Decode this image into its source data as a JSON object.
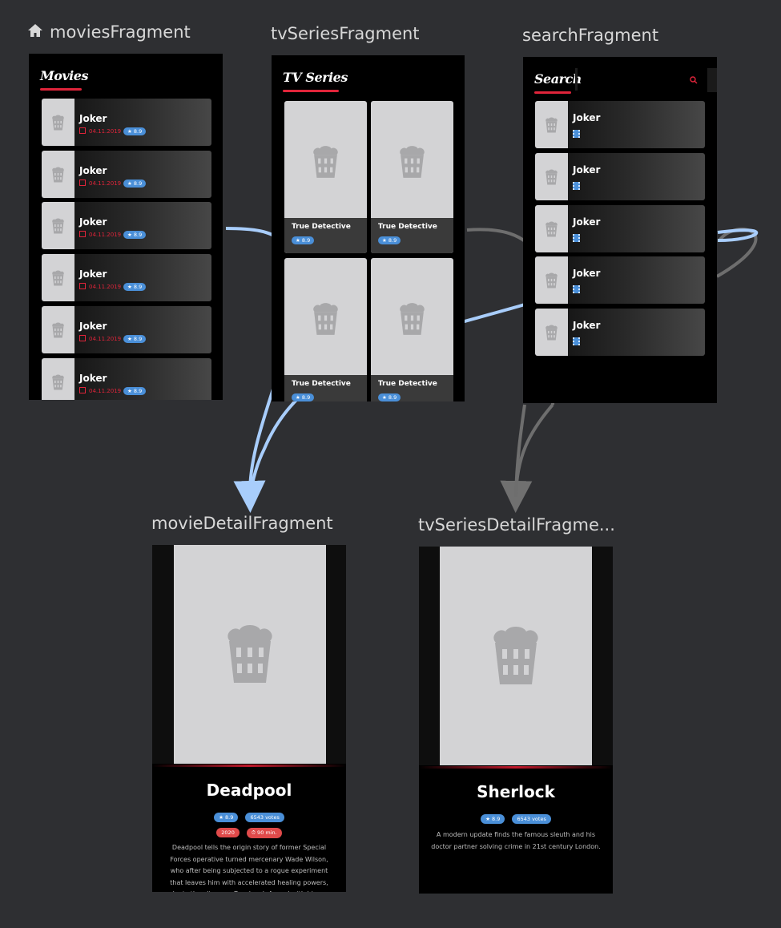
{
  "fragments": {
    "movies": {
      "label": "moviesFragment",
      "screen_title": "Movies",
      "items": [
        {
          "title": "Joker",
          "date": "04.11.2019",
          "rating": "★ 8.9"
        },
        {
          "title": "Joker",
          "date": "04.11.2019",
          "rating": "★ 8.9"
        },
        {
          "title": "Joker",
          "date": "04.11.2019",
          "rating": "★ 8.9"
        },
        {
          "title": "Joker",
          "date": "04.11.2019",
          "rating": "★ 8.9"
        },
        {
          "title": "Joker",
          "date": "04.11.2019",
          "rating": "★ 8.9"
        },
        {
          "title": "Joker",
          "date": "04.11.2019",
          "rating": "★ 8.9"
        }
      ]
    },
    "tvSeries": {
      "label": "tvSeriesFragment",
      "screen_title": "TV Series",
      "items": [
        {
          "title": "True Detective",
          "rating": "★ 8.9"
        },
        {
          "title": "True Detective",
          "rating": "★ 8.9"
        },
        {
          "title": "True Detective",
          "rating": "★ 8.9"
        },
        {
          "title": "True Detective",
          "rating": "★ 8.9"
        }
      ]
    },
    "search": {
      "label": "searchFragment",
      "screen_title": "Search",
      "items": [
        {
          "title": "Joker"
        },
        {
          "title": "Joker"
        },
        {
          "title": "Joker"
        },
        {
          "title": "Joker"
        },
        {
          "title": "Joker"
        }
      ]
    },
    "movieDetail": {
      "label": "movieDetailFragment",
      "title": "Deadpool",
      "rating": "★ 8.9",
      "votes": "6543 votes",
      "year": "2020",
      "runtime": "⏱ 90 min.",
      "description": "Deadpool tells the origin story of former Special Forces operative turned mercenary Wade Wilson, who after being subjected to a rogue experiment that leaves him with accelerated healing powers, adopts the alter ego Deadpool. Armed with his new abilities and a dark"
    },
    "tvSeriesDetail": {
      "label": "tvSeriesDetailFragme...",
      "title": "Sherlock",
      "rating": "★ 8.9",
      "votes": "6543 votes",
      "description": "A modern update finds the famous sleuth and his doctor partner solving crime in 21st century London."
    }
  },
  "colors": {
    "canvas": "#2e2f32",
    "accent_red": "#e0243a",
    "badge_blue": "#4a8fd8",
    "arrow_selected": "#a8cdfb",
    "arrow_default": "#707070"
  },
  "icons": {
    "start_destination": "home-icon",
    "placeholder": "popcorn-icon",
    "search": "search-icon",
    "date": "calendar-icon",
    "media_type": "film-icon"
  }
}
